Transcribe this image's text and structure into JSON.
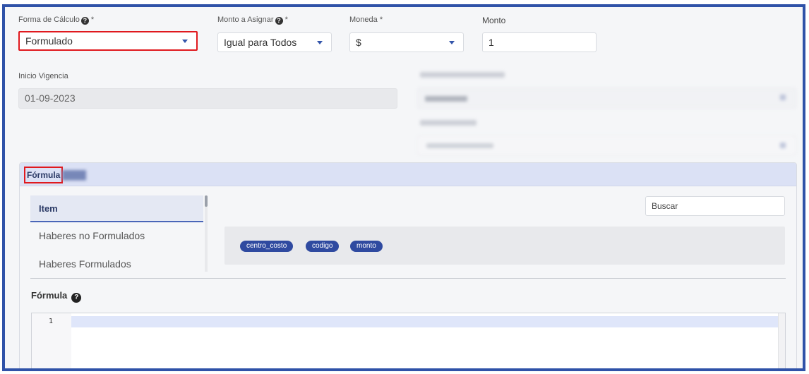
{
  "form": {
    "calc_form": {
      "label": "Forma de Cálculo",
      "required": "*",
      "value": "Formulado"
    },
    "assign_amount": {
      "label": "Monto a Asignar",
      "required": "*",
      "value": "Igual para Todos"
    },
    "currency": {
      "label": "Moneda",
      "required": "*",
      "value": "$"
    },
    "amount": {
      "label": "Monto",
      "value": "1"
    },
    "start_date": {
      "label": "Inicio Vigencia",
      "value": "01-09-2023"
    }
  },
  "panel": {
    "title": "Fórmula",
    "list_items": [
      {
        "label": "Item"
      },
      {
        "label": "Haberes no Formulados"
      },
      {
        "label": "Haberes Formulados"
      }
    ],
    "search_placeholder": "Buscar",
    "chips": [
      "centro_costo",
      "codigo",
      "monto"
    ],
    "formula_label": "Fórmula",
    "editor": {
      "line_numbers": [
        "1"
      ]
    }
  },
  "icons": {
    "help": "question-circle-icon",
    "dropdown": "caret-down-icon"
  },
  "colors": {
    "frame_border": "#2f52a8",
    "highlight": "#e0191e",
    "chip_bg": "#2f4aa0",
    "panel_header_bg": "#dbe1f5"
  }
}
